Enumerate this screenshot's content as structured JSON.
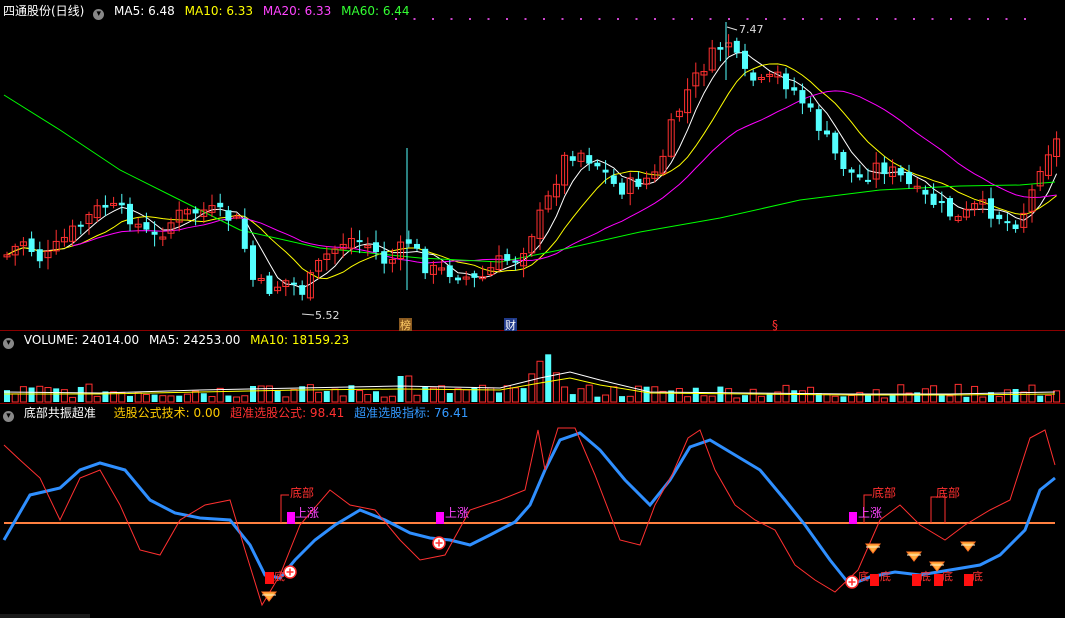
{
  "main": {
    "title": "四通股份(日线)",
    "ma": [
      {
        "label": "MA5: 6.48",
        "color": "#ffffff"
      },
      {
        "label": "MA10: 6.33",
        "color": "#ffff00"
      },
      {
        "label": "MA20: 6.33",
        "color": "#ff00ff"
      },
      {
        "label": "MA60: 6.44",
        "color": "#00ff00"
      }
    ],
    "high_label": "7.47",
    "low_label": "5.52",
    "markers": [
      {
        "text": "榜",
        "bg": "#8a5a20",
        "color": "#ffcc66"
      },
      {
        "text": "财",
        "bg": "#203a8a",
        "color": "#ffffff"
      },
      {
        "text": "§",
        "bg": "none",
        "color": "#ff3030"
      }
    ]
  },
  "volume": {
    "labels": [
      {
        "label": "VOLUME: 24014.00",
        "color": "#ffffff"
      },
      {
        "label": "MA5: 24253.00",
        "color": "#ffffff"
      },
      {
        "label": "MA10: 18159.23",
        "color": "#ffff00"
      }
    ]
  },
  "indicator": {
    "title": "底部共振超准",
    "labels": [
      {
        "label": "选股公式技术: 0.00",
        "color": "#ffcc00"
      },
      {
        "label": "超准选股公式: 98.41",
        "color": "#ff3030"
      },
      {
        "label": "超准选股指标: 76.41",
        "color": "#3399ff"
      }
    ],
    "tags": {
      "bottom": "底部",
      "rise": "上涨",
      "di": "底"
    }
  },
  "colors": {
    "up": "#ff3030",
    "down": "#54ffff",
    "ma5": "#ffffff",
    "ma10": "#ffff00",
    "ma20": "#ff00ff",
    "ma60": "#00ff00",
    "baseline": "#ff8040",
    "blue": "#2f8fff"
  }
}
